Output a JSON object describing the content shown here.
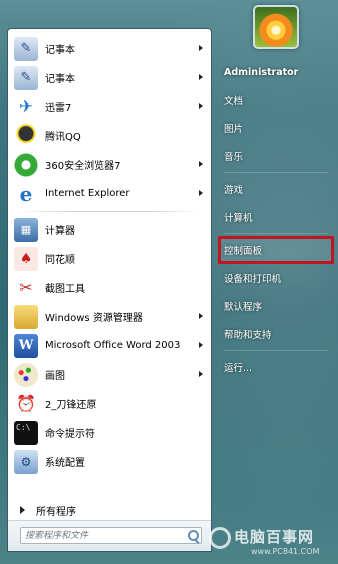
{
  "start_menu": {
    "programs": [
      {
        "label": "记事本",
        "icon": "notepad-icon",
        "submenu": true
      },
      {
        "label": "记事本",
        "icon": "notepad-icon",
        "submenu": true
      },
      {
        "label": "迅雷7",
        "icon": "thunder-bird-icon",
        "submenu": true
      },
      {
        "label": "腾讯QQ",
        "icon": "qq-penguin-icon",
        "submenu": false
      },
      {
        "label": "360安全浏览器7",
        "icon": "browser-360-icon",
        "submenu": true
      },
      {
        "label": "Internet Explorer",
        "icon": "internet-explorer-icon",
        "submenu": true
      },
      {
        "label": "计算器",
        "icon": "calculator-icon",
        "submenu": false
      },
      {
        "label": "同花顺",
        "icon": "tonghuashun-icon",
        "submenu": false
      },
      {
        "label": "截图工具",
        "icon": "snipping-tool-icon",
        "submenu": false
      },
      {
        "label": "Windows 资源管理器",
        "icon": "windows-explorer-icon",
        "submenu": true
      },
      {
        "label": "Microsoft Office Word 2003",
        "icon": "word-icon",
        "submenu": true
      },
      {
        "label": "画图",
        "icon": "paint-icon",
        "submenu": true
      },
      {
        "label": "2_刀锋还原",
        "icon": "restore-tool-icon",
        "submenu": false
      },
      {
        "label": "命令提示符",
        "icon": "command-prompt-icon",
        "submenu": false
      },
      {
        "label": "系统配置",
        "icon": "system-config-icon",
        "submenu": false
      }
    ],
    "all_programs_label": "所有程序",
    "search_placeholder": "搜索程序和文件",
    "user_name": "Administrator",
    "right_items": [
      {
        "label": "文档"
      },
      {
        "label": "图片"
      },
      {
        "label": "音乐"
      },
      {
        "label": "游戏"
      },
      {
        "label": "计算机"
      },
      {
        "label": "控制面板",
        "highlighted": true
      },
      {
        "label": "设备和打印机"
      },
      {
        "label": "默认程序"
      },
      {
        "label": "帮助和支持"
      },
      {
        "label": "运行..."
      }
    ],
    "highlight_color": "#c0161f"
  },
  "watermark": {
    "title": "电脑百事网",
    "url": "www.PC841.COM"
  }
}
